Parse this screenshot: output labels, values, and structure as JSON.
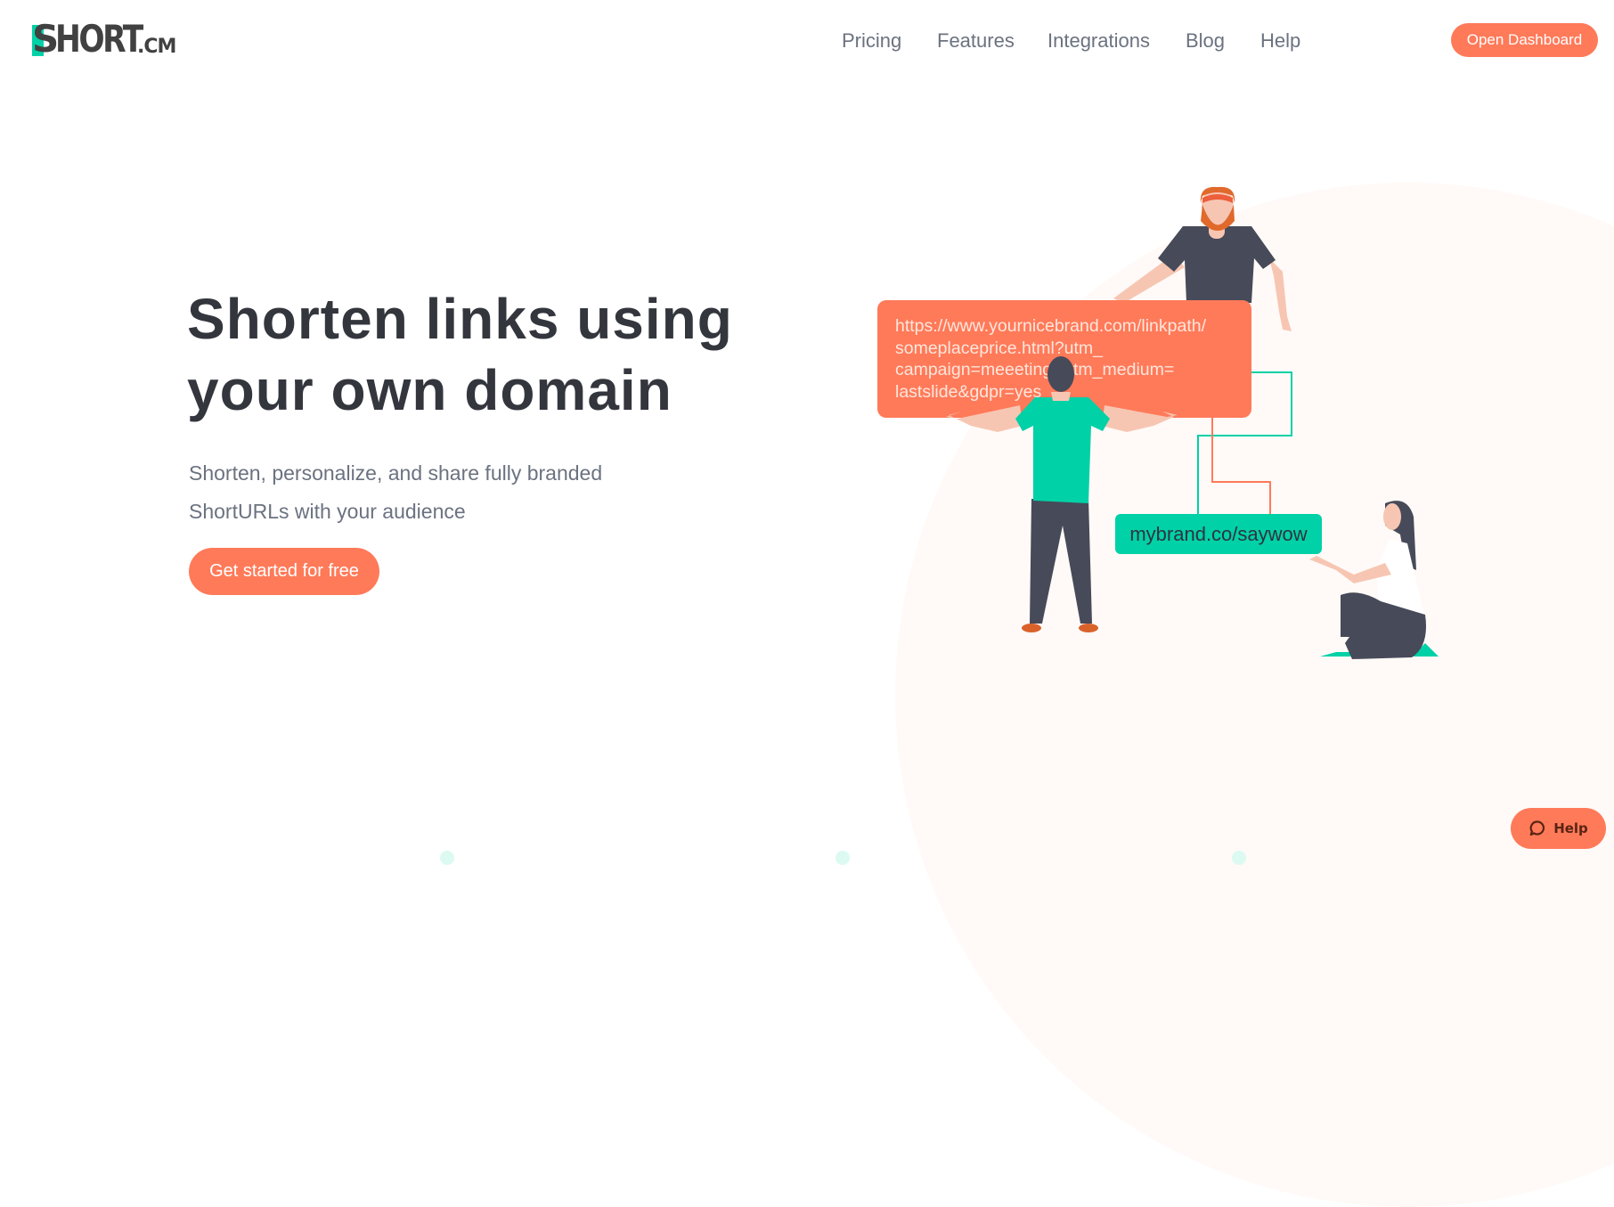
{
  "logo": {
    "first_letter": "S",
    "rest": "HORT",
    "suffix": ".CM",
    "accent_color": "#00d1a7"
  },
  "nav": {
    "items": [
      {
        "label": "Pricing"
      },
      {
        "label": "Features"
      },
      {
        "label": "Integrations"
      },
      {
        "label": "Blog"
      },
      {
        "label": "Help"
      }
    ],
    "cta_label": "Open Dashboard"
  },
  "hero": {
    "title_line1": "Shorten links using",
    "title_line2": "your own domain",
    "subtitle_line1": "Shorten, personalize, and share fully branded",
    "subtitle_line2": "ShortURLs with your audience",
    "cta_label": "Get started for free"
  },
  "illustration": {
    "long_url": "https://www.yournicebrand.com/linkpath/someplaceprice.html?utm_campaign=meeeting&utm_medium=lastslide&gdpr=yes",
    "long_url_lines": [
      "https://www.yournicebrand.com/linkpath/",
      "someplaceprice.html?utm_",
      "campaign=meeeting&utm_medium=",
      "lastslide&gdpr=yes"
    ],
    "short_url": "mybrand.co/saywow"
  },
  "help_widget": {
    "label": "Help",
    "icon": "chat-bubble-icon"
  },
  "colors": {
    "brand_orange": "#ff7a59",
    "brand_teal": "#00d1a7",
    "heading": "#33363d",
    "body_text": "#6b7280"
  }
}
